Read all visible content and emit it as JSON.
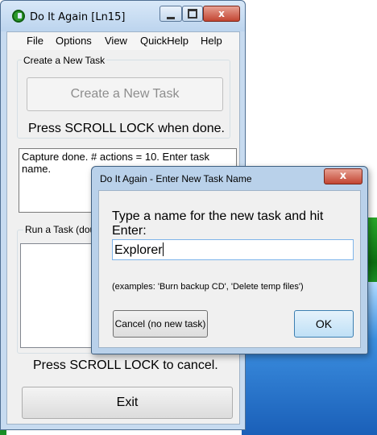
{
  "main_window": {
    "title": "Do It Again [Ln15]",
    "controls": {
      "minimize": "",
      "maximize": "",
      "close": "x"
    }
  },
  "menu": {
    "items": [
      "File",
      "Options",
      "View",
      "QuickHelp",
      "Help"
    ]
  },
  "create_group": {
    "label": "Create a New Task",
    "button_label": "Create a New Task",
    "hint": "Press SCROLL LOCK when done."
  },
  "status": {
    "text": "Capture done. # actions = 10. Enter task name."
  },
  "run_group": {
    "label": "Run a Task (doub",
    "hint": "Press SCROLL LOCK to cancel."
  },
  "exit_button": {
    "label": "Exit"
  },
  "dialog": {
    "title": "Do It Again - Enter New Task Name",
    "close_label": "x",
    "prompt": "Type a name for the new task and hit Enter:",
    "input_value": "Explorer",
    "examples": "(examples: 'Burn backup CD', 'Delete temp files')",
    "cancel_label": "Cancel (no new task)",
    "ok_label": "OK"
  },
  "colors": {
    "title_bar": "#c7dbf0",
    "close_button": "#c24532",
    "focus_border": "#7eb4ea"
  }
}
